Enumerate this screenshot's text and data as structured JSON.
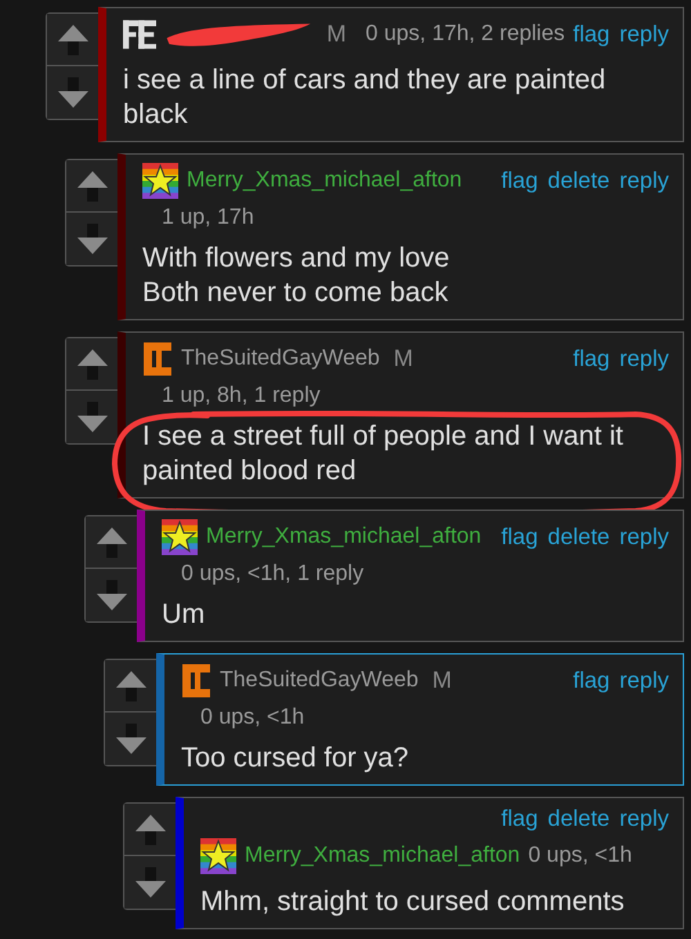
{
  "comments": [
    {
      "kind": "inline",
      "avatar": {
        "kind": "blocks"
      },
      "label": "M",
      "meta": "0 ups, 17h, 2 replies",
      "actions": [
        "flag",
        "reply"
      ],
      "color": "#8b0000",
      "highlighted": false,
      "text": "i see a line of cars and they are painted black",
      "children": [
        {
          "kind": "stacked",
          "avatar": {
            "kind": "star"
          },
          "author": {
            "name": "Merry_Xmas_michael_afton",
            "color": "#3fae3f"
          },
          "meta": "1 up, 17h",
          "actions": [
            "flag",
            "delete",
            "reply"
          ],
          "color": "#4a0000",
          "highlighted": false,
          "text": "With flowers and my love\nBoth never to come back"
        },
        {
          "kind": "stacked",
          "avatar": {
            "kind": "bracket"
          },
          "author": {
            "name": "TheSuitedGayWeeb",
            "color": "#9a9a9a"
          },
          "label": "M",
          "meta": "1 up, 8h, 1 reply",
          "actions": [
            "flag",
            "reply"
          ],
          "color": "#3a0000",
          "highlighted": false,
          "circled": true,
          "text": "I see a street full of people and I want it painted blood red",
          "children": [
            {
              "kind": "stacked",
              "avatar": {
                "kind": "star"
              },
              "author": {
                "name": "Merry_Xmas_michael_afton",
                "color": "#3fae3f"
              },
              "meta": "0 ups, <1h, 1 reply",
              "actions": [
                "flag",
                "delete",
                "reply"
              ],
              "color": "#8b008b",
              "highlighted": false,
              "text": "Um",
              "children": [
                {
                  "kind": "stacked",
                  "avatar": {
                    "kind": "bracket"
                  },
                  "author": {
                    "name": "TheSuitedGayWeeb",
                    "color": "#9a9a9a"
                  },
                  "label": "M",
                  "meta": "0 ups, <1h",
                  "actions": [
                    "flag",
                    "reply"
                  ],
                  "color": "#1565a8",
                  "highlighted": true,
                  "text": "Too cursed for ya?",
                  "children": [
                    {
                      "kind": "actions_top",
                      "avatar": {
                        "kind": "star"
                      },
                      "author": {
                        "name": "Merry_Xmas_michael_afton",
                        "color": "#3fae3f"
                      },
                      "meta": "0 ups, <1h",
                      "actions": [
                        "flag",
                        "delete",
                        "reply"
                      ],
                      "color": "#0000cc",
                      "highlighted": false,
                      "text": "Mhm, straight to cursed comments"
                    }
                  ]
                }
              ]
            }
          ]
        }
      ]
    }
  ]
}
